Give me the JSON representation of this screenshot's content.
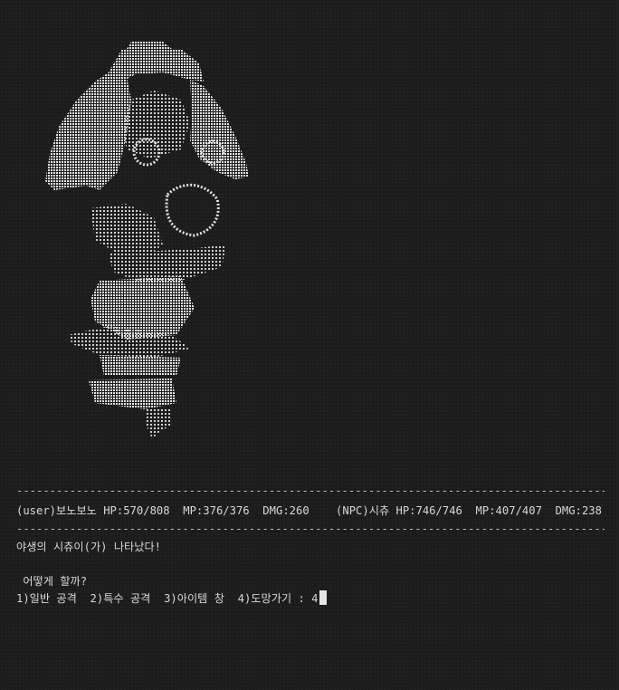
{
  "colors": {
    "background": "#1c1c1c",
    "text": "#d8d8d8",
    "art": "#e2e2e2",
    "cursor": "#e6e6e6"
  },
  "status": {
    "divider": "-----------------------------------------------------------------------------------------------",
    "user_line": "(user)보노보노 HP:570/808  MP:376/376  DMG:260",
    "npc_line": "(NPC)시츄 HP:746/746  MP:407/407  DMG:238"
  },
  "messages": {
    "encounter": "야생의 시츄이(가) 나타났다!",
    "prompt": " 어떻게 할까?",
    "menu": "1)일반 공격  2)특수 공격  3)아이템 창  4)도망가기 : ",
    "input_value": "4"
  },
  "art": {
    "icon": "shih-tzu-ascii-art"
  }
}
